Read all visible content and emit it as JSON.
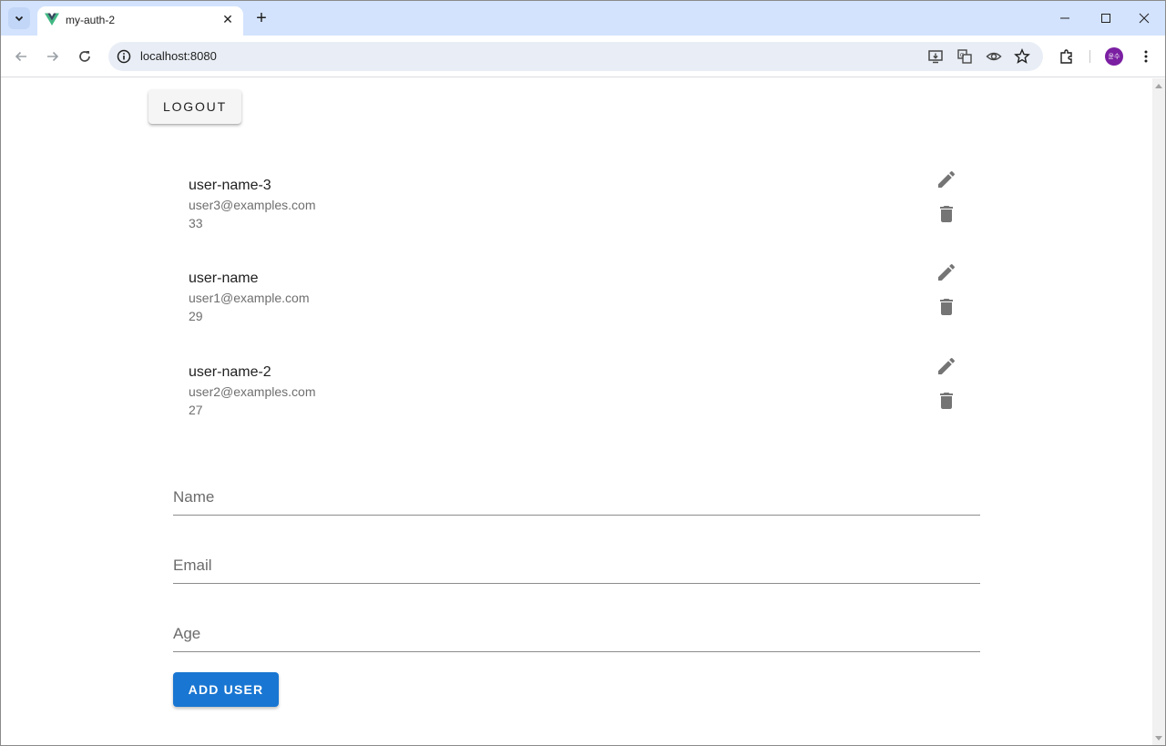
{
  "browser": {
    "tab_title": "my-auth-2",
    "url": "localhost:8080",
    "avatar_text": "윤수"
  },
  "page": {
    "logout_label": "LOGOUT",
    "users": [
      {
        "name": "user-name-3",
        "email": "user3@examples.com",
        "age": "33"
      },
      {
        "name": "user-name",
        "email": "user1@example.com",
        "age": "29"
      },
      {
        "name": "user-name-2",
        "email": "user2@examples.com",
        "age": "27"
      }
    ],
    "form": {
      "name_placeholder": "Name",
      "email_placeholder": "Email",
      "age_placeholder": "Age",
      "add_label": "ADD USER"
    }
  },
  "colors": {
    "tabstrip_bg": "#d3e3fd",
    "primary": "#1976d2",
    "vue_green": "#41b883",
    "vue_dark": "#35495e"
  }
}
